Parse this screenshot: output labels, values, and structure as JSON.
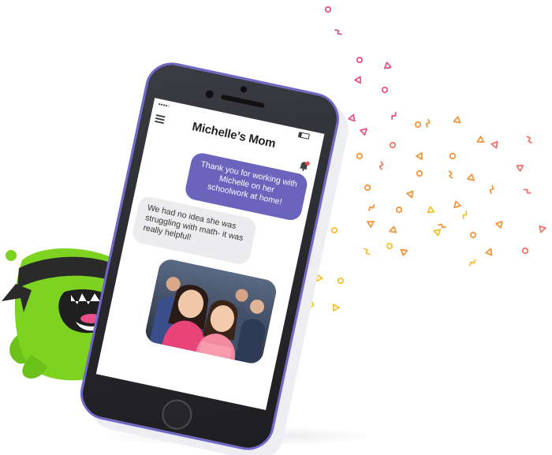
{
  "conversation": {
    "title": "Michelle’s Mom",
    "messages": [
      {
        "text": "Thank you for working with Michelle on her schoolwork at home!"
      },
      {
        "text": "We had no idea she was struggling with math- it was really helpful!"
      }
    ]
  },
  "colors": {
    "accent": "#6a64bd",
    "phone_border": "#6f68c6",
    "monster_green": "#7ed321",
    "confetti": [
      "#e8508a",
      "#f3953a",
      "#f6c22c",
      "#f07468"
    ]
  },
  "icons": [
    "menu-icon",
    "bell-icon",
    "wifi-icon",
    "battery-icon"
  ]
}
